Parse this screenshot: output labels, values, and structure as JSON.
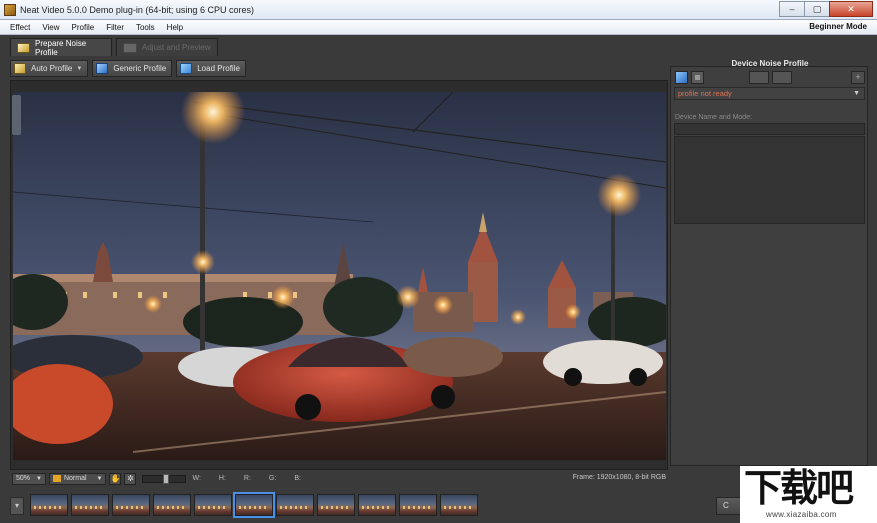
{
  "window": {
    "title": "Neat Video 5.0.0 Demo plug-in (64-bit; using 6 CPU cores)",
    "buttons": [
      "–",
      "▢",
      "✕"
    ]
  },
  "menu": {
    "items": [
      "Effect",
      "View",
      "Profile",
      "Filter",
      "Tools",
      "Help"
    ],
    "mode": "Beginner Mode"
  },
  "tabs": [
    {
      "label": "Prepare Noise Profile",
      "active": true
    },
    {
      "label": "Adjust and Preview",
      "active": false
    }
  ],
  "toolbar": {
    "auto_profile": "Auto Profile",
    "generic_profile": "Generic Profile",
    "load_profile": "Load Profile"
  },
  "statusbar": {
    "zoom": "50%",
    "blend_mode": "Normal",
    "w_label": "W:",
    "h_label": "H:",
    "r_label": "R:",
    "g_label": "G:",
    "b_label": "B:",
    "frame_info": "Frame: 1920x1080, 8-bit RGB"
  },
  "right_panel": {
    "title": "Device Noise Profile",
    "profile_status": "profile not ready",
    "device_label": "Device Name and Mode:",
    "colors": {
      "status": "#e07050"
    }
  },
  "filmstrip": {
    "thumb_count": 11,
    "selected_index": 5,
    "right_button_label": "C"
  },
  "watermark": {
    "brand": "下载吧",
    "url": "www.xiazaiba.com"
  }
}
